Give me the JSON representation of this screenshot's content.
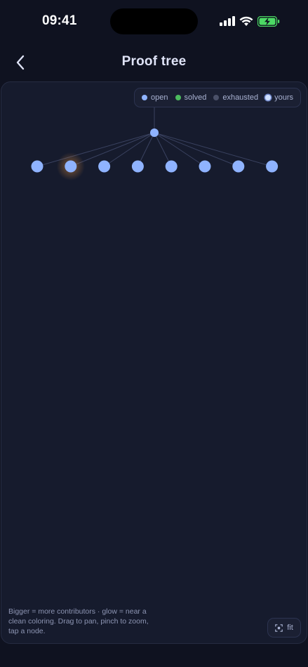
{
  "status_bar": {
    "time": "09:41"
  },
  "nav": {
    "title": "Proof tree",
    "back_icon": "chevron-left-icon"
  },
  "legend": {
    "items": [
      {
        "label": "open",
        "color": "#8fb3ff"
      },
      {
        "label": "solved",
        "color": "#4cbb5e"
      },
      {
        "label": "exhausted",
        "color": "#4a5068"
      },
      {
        "label": "yours",
        "color": "#cfe0ff"
      }
    ]
  },
  "tree": {
    "root": {
      "status": "open"
    },
    "children": [
      {
        "status": "open",
        "glow": false
      },
      {
        "status": "open",
        "glow": true
      },
      {
        "status": "open",
        "glow": false
      },
      {
        "status": "open",
        "glow": false
      },
      {
        "status": "open",
        "glow": false
      },
      {
        "status": "open",
        "glow": false
      },
      {
        "status": "open",
        "glow": false
      },
      {
        "status": "open",
        "glow": false
      }
    ],
    "colors": {
      "node": "#8fb3ff",
      "edge": "#3a4260",
      "glow": "#d98a3c"
    }
  },
  "hint": "Bigger = more contributors · glow = near a clean coloring. Drag to pan, pinch to zoom, tap a node.",
  "fit_button": {
    "label": "fit",
    "icon": "fit-icon"
  }
}
